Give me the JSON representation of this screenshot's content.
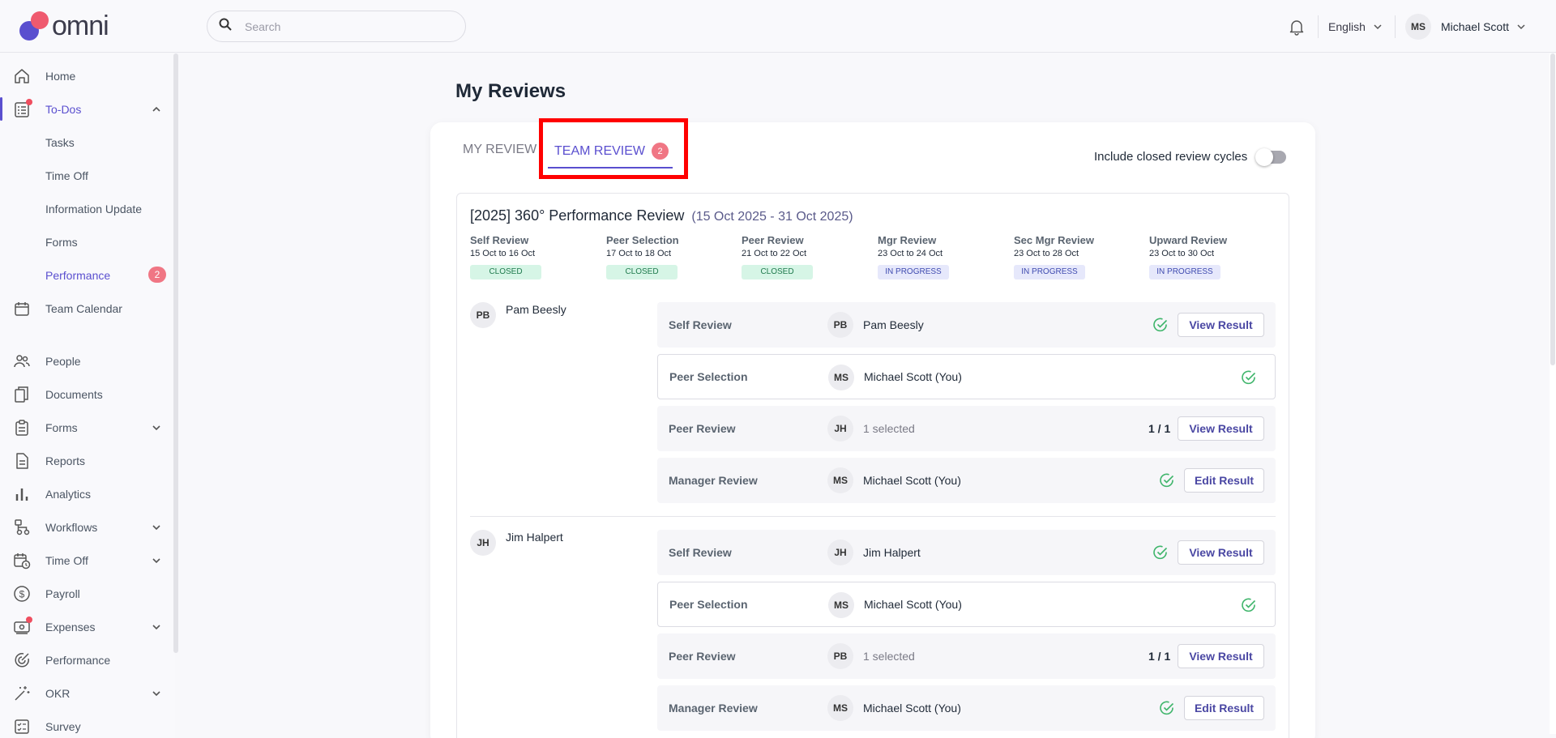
{
  "brand": {
    "name": "omni"
  },
  "search": {
    "placeholder": "Search"
  },
  "header": {
    "language": "English",
    "user_initials": "MS",
    "user_name": "Michael Scott"
  },
  "sidebar": {
    "home": "Home",
    "todos": "To-Dos",
    "todos_sub": [
      "Tasks",
      "Time Off",
      "Information Update",
      "Forms",
      "Performance"
    ],
    "performance_badge": "2",
    "team_calendar": "Team Calendar",
    "people": "People",
    "documents": "Documents",
    "forms": "Forms",
    "reports": "Reports",
    "analytics": "Analytics",
    "workflows": "Workflows",
    "time_off": "Time Off",
    "payroll": "Payroll",
    "expenses": "Expenses",
    "performance": "Performance",
    "okr": "OKR",
    "survey": "Survey"
  },
  "page": {
    "title": "My Reviews"
  },
  "tabs": {
    "my_review": "MY REVIEW",
    "team_review": "TEAM REVIEW",
    "team_review_badge": "2"
  },
  "toggle": {
    "label": "Include closed review cycles",
    "on": false
  },
  "cycle": {
    "title": "[2025] 360° Performance Review",
    "dates": "(15 Oct 2025 - 31 Oct 2025)",
    "stages": [
      {
        "name": "Self Review",
        "dates": "15 Oct to 16 Oct",
        "status": "CLOSED"
      },
      {
        "name": "Peer Selection",
        "dates": "17 Oct to 18 Oct",
        "status": "CLOSED"
      },
      {
        "name": "Peer Review",
        "dates": "21 Oct to 22 Oct",
        "status": "CLOSED"
      },
      {
        "name": "Mgr Review",
        "dates": "23 Oct to 24 Oct",
        "status": "IN PROGRESS"
      },
      {
        "name": "Sec Mgr Review",
        "dates": "23 Oct to 28 Oct",
        "status": "IN PROGRESS"
      },
      {
        "name": "Upward Review",
        "dates": "23 Oct to 30 Oct",
        "status": "IN PROGRESS"
      }
    ]
  },
  "reviewees": [
    {
      "initials": "PB",
      "name": "Pam Beesly",
      "rows": [
        {
          "label": "Self Review",
          "initials": "PB",
          "reviewer": "Pam Beesly",
          "button": "View Result"
        },
        {
          "label": "Peer Selection",
          "initials": "MS",
          "reviewer": "Michael Scott (You)"
        },
        {
          "label": "Peer Review",
          "initials": "JH",
          "reviewer": "1 selected",
          "count": "1 / 1",
          "button": "View Result"
        },
        {
          "label": "Manager Review",
          "initials": "MS",
          "reviewer": "Michael Scott (You)",
          "button": "Edit Result"
        }
      ]
    },
    {
      "initials": "JH",
      "name": "Jim Halpert",
      "rows": [
        {
          "label": "Self Review",
          "initials": "JH",
          "reviewer": "Jim Halpert",
          "button": "View Result"
        },
        {
          "label": "Peer Selection",
          "initials": "MS",
          "reviewer": "Michael Scott (You)"
        },
        {
          "label": "Peer Review",
          "initials": "PB",
          "reviewer": "1 selected",
          "count": "1 / 1",
          "button": "View Result"
        },
        {
          "label": "Manager Review",
          "initials": "MS",
          "reviewer": "Michael Scott (You)",
          "button": "Edit Result"
        }
      ]
    }
  ],
  "colors": {
    "accent": "#5a4fcf",
    "badge": "#f07684",
    "check": "#3fb56b",
    "highlight": "#ff0000"
  }
}
